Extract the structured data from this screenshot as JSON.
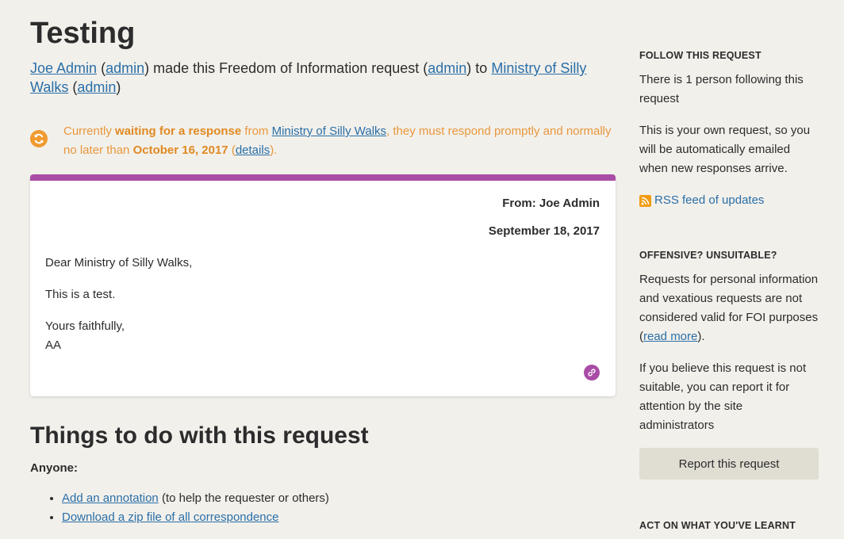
{
  "request": {
    "title": "Testing",
    "byline": {
      "user": "Joe Admin",
      "user_admin": "admin",
      "middle": "made this Freedom of Information request",
      "req_admin": "admin",
      "to": "to",
      "authority": "Ministry of Silly Walks",
      "authority_admin": "admin"
    }
  },
  "status": {
    "text1": "Currently",
    "bold1": "waiting for a response",
    "text2": "from",
    "authority": "Ministry of Silly Walks",
    "text3": ", they must respond promptly and normally no later than",
    "date": "October 16, 2017",
    "details": "details",
    "icon": "refresh-icon"
  },
  "message": {
    "from": "From: Joe Admin",
    "date": "September 18, 2017",
    "greeting": "Dear Ministry of Silly Walks,",
    "body": "This is a test.",
    "signoff": "Yours faithfully,",
    "signature": "AA",
    "accent_color": "#a94ca6",
    "link_icon": "link-icon"
  },
  "things": {
    "title": "Things to do with this request",
    "anyone": "Anyone:",
    "items": [
      {
        "link": "Add an annotation",
        "note": "(to help the requester or others)"
      },
      {
        "link": "Download a zip file of all correspondence",
        "note": ""
      }
    ]
  },
  "sidebar": {
    "follow": {
      "heading": "FOLLOW THIS REQUEST",
      "count_text": "There is 1 person following this request",
      "own_text": "This is your own request, so you will be automatically emailed when new responses arrive.",
      "rss": "RSS feed of updates"
    },
    "offensive": {
      "heading": "OFFENSIVE? UNSUITABLE?",
      "text": "Requests for personal information and vexatious requests are not considered valid for FOI purposes (",
      "read_more": "read more",
      "text_end": ").",
      "report_text": "If you believe this request is not suitable, you can report it for attention by the site administrators",
      "report_button": "Report this request"
    },
    "act": {
      "heading": "ACT ON WHAT YOU'VE LEARNT"
    }
  },
  "colors": {
    "background": "#f2f0eb",
    "link": "#2a6fa7",
    "status": "#e8973c",
    "message_border": "#a94ca6"
  }
}
